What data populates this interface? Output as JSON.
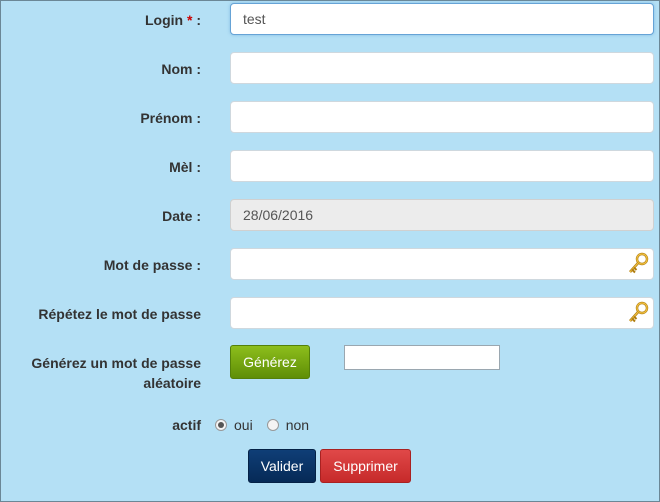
{
  "form": {
    "login": {
      "label": "Login",
      "required_marker": "*",
      "suffix": " :",
      "value": "test"
    },
    "nom": {
      "label": "Nom :",
      "value": ""
    },
    "prenom": {
      "label": "Prénom :",
      "value": ""
    },
    "mel": {
      "label": "Mèl :",
      "value": ""
    },
    "date": {
      "label": "Date :",
      "value": "28/06/2016"
    },
    "mot_de_passe": {
      "label": "Mot de passe :",
      "value": "",
      "icon": "key-icon"
    },
    "repetez": {
      "label": "Répétez le mot de passe",
      "value": "",
      "icon": "key-icon"
    },
    "generez": {
      "label_line1": "Générez un mot de passe",
      "label_line2": "aléatoire",
      "button_label": "Générez",
      "value": ""
    },
    "actif": {
      "label": "actif",
      "options": [
        "oui",
        "non"
      ],
      "selected": "oui"
    },
    "buttons": {
      "valider": "Valider",
      "supprimer": "Supprimer"
    }
  },
  "colors": {
    "background": "#b4e0f5",
    "generate_button": "#6f9f0c",
    "validate_button": "#0a3466",
    "delete_button": "#d23a3a",
    "required": "#cc0000"
  }
}
